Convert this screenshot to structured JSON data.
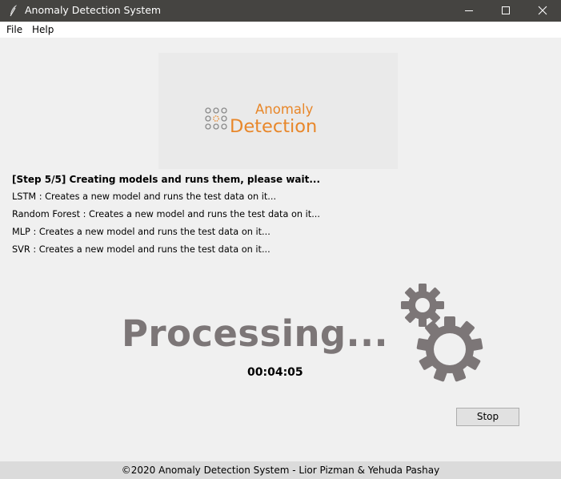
{
  "window": {
    "title": "Anomaly Detection System",
    "icon": "feather-icon"
  },
  "menu": {
    "items": [
      {
        "label": "File"
      },
      {
        "label": "Help"
      }
    ]
  },
  "logo": {
    "line1": "Anomaly",
    "line2": "Detection",
    "color": "#e8872a"
  },
  "status": {
    "heading": "[Step 5/5] Creating models and runs them, please wait...",
    "lines": [
      "LSTM : Creates a new model and runs the test data on it...",
      "Random Forest : Creates a new model and runs the test data on it...",
      "MLP : Creates a new model and runs the test data on it...",
      "SVR : Creates a new model and runs the test data on it..."
    ]
  },
  "processing": {
    "label": "Processing...",
    "timer": "00:04:05",
    "icon": "gears-icon",
    "color": "#7c7677"
  },
  "actions": {
    "stop_label": "Stop"
  },
  "footer": {
    "text": "©2020 Anomaly Detection System - Lior Pizman & Yehuda Pashay"
  },
  "colors": {
    "titlebar": "#454441",
    "background": "#f0f0f0",
    "footer": "#dbdbdb"
  }
}
